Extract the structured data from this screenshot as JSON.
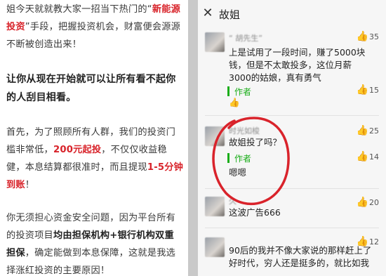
{
  "article": {
    "p1_a": "姐今天就就教大家一招当下热门的“",
    "p1_hl": "新能源投资",
    "p1_b": "”手段，把握投资机会，财富便会源源不断被创造出来！",
    "p2": "让你从现在开始就可以让所有看不起你的人刮目相看。",
    "p3_a": "首先，为了照顾所有人群，我们的投资门槛非常低，",
    "p3_hl1": "200元起投",
    "p3_b": "，不仅仅收益稳健，本息结算都很准时，而且提现",
    "p3_hl2": "1-5分钟到账",
    "p3_c": "！",
    "p4_a": "你无须担心资金安全问题，因为平台所有的投资项目",
    "p4_hl": "均由担保机构+银行机构双重担保",
    "p4_b": "，确定能做到本息保障，这就是我选择涨红投资的主要原因！"
  },
  "wechat": {
    "close_label": "✕",
    "title": "故姐",
    "comments": [
      {
        "nick": "“ 胡先生”",
        "text": "上是试用了一段时间，赚了5000块钱，但是不太敢投多，这位月薪3000的姑娘，真有勇气",
        "likes": "35",
        "reply_author": "作者",
        "reply_text": "👍",
        "reply_likes": "15"
      },
      {
        "nick": "时光如梭",
        "text": "故姐投了吗？",
        "likes": "25",
        "reply_author": "作者",
        "reply_text": "嗯嗯",
        "reply_likes": "14"
      },
      {
        "nick": "久",
        "text": "这波广告666",
        "likes": "20",
        "reply_author": "",
        "reply_text": "",
        "reply_likes": ""
      },
      {
        "nick": "",
        "text": "90后的我并不像大家说的那样赶上了好时代，穷人还是挺多的，就比如我",
        "likes": "12",
        "reply_author": "",
        "reply_text": "",
        "reply_likes": ""
      }
    ]
  },
  "colors": {
    "highlight_red": "#d8232a",
    "author_green": "#1aad19",
    "circle_red": "#d9232b"
  }
}
